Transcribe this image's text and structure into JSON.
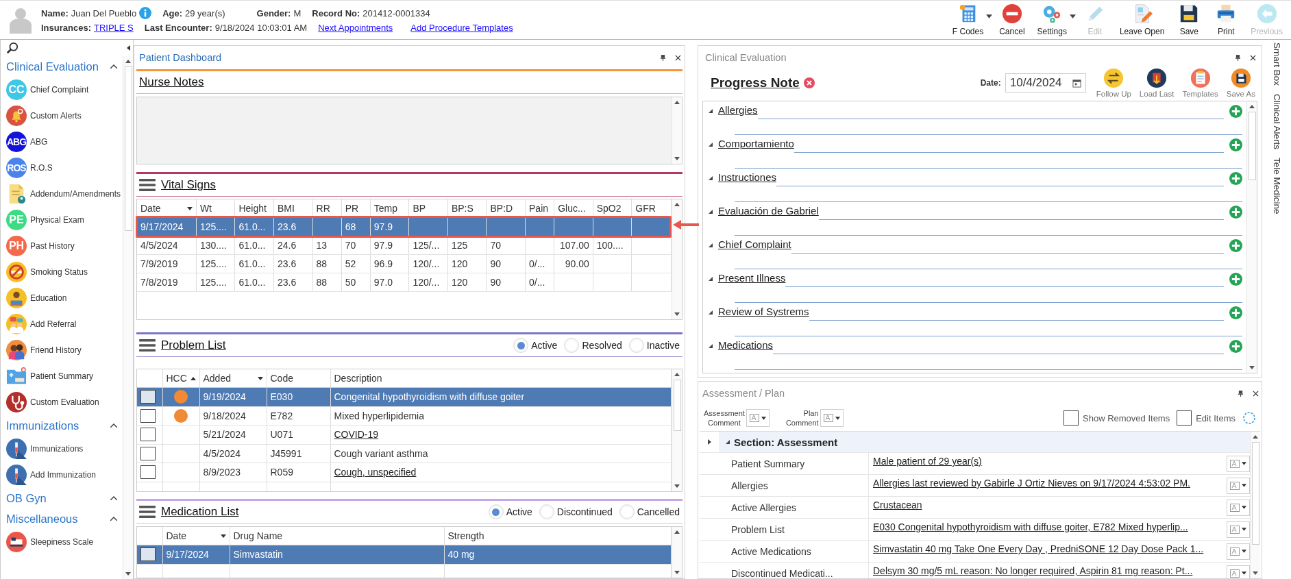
{
  "header": {
    "line1": [
      {
        "label": "Name:",
        "value": "Juan Del Pueblo",
        "info": true
      },
      {
        "label": "Age:",
        "value": "29 year(s)"
      },
      {
        "label": "Gender:",
        "value": "M"
      },
      {
        "label": "Record No:",
        "value": "201412-0001334"
      }
    ],
    "line2": [
      {
        "label": "Insurances:",
        "value": "TRIPLE S",
        "link": true
      },
      {
        "label": "Last Encounter:",
        "value": "9/18/2024 10:03:01 AM"
      }
    ],
    "links": [
      "Next Appointments",
      "Add Procedure Templates"
    ],
    "toolbar": [
      {
        "label": "F Codes",
        "menu": true,
        "disabled": false
      },
      {
        "label": "Cancel",
        "menu": false,
        "disabled": false
      },
      {
        "label": "Settings",
        "menu": true,
        "disabled": false
      },
      {
        "label": "Edit",
        "menu": false,
        "disabled": true
      },
      {
        "label": "Leave Open",
        "menu": false,
        "disabled": false
      },
      {
        "label": "Save",
        "menu": false,
        "disabled": false
      },
      {
        "label": "Print",
        "menu": false,
        "disabled": false
      },
      {
        "label": "Previous",
        "menu": false,
        "disabled": true
      }
    ]
  },
  "sidebar": {
    "groups": [
      {
        "title": "Clinical Evaluation",
        "expanded": true,
        "items": [
          {
            "label": "Chief Complaint",
            "badge": "CC",
            "color": "#3fc7e6"
          },
          {
            "label": "Custom Alerts"
          },
          {
            "label": "ABG",
            "badge": "ABG",
            "color": "#1212d8"
          },
          {
            "label": "R.O.S",
            "badge": "ROS",
            "color": "#4a83ea"
          },
          {
            "label": "Addendum/Amendments"
          },
          {
            "label": "Physical Exam",
            "badge": "PE",
            "color": "#3ddc84"
          },
          {
            "label": "Past History",
            "badge": "PH",
            "color": "#f4694b"
          },
          {
            "label": "Smoking Status"
          },
          {
            "label": "Education"
          },
          {
            "label": "Add Referral"
          },
          {
            "label": "Friend History"
          },
          {
            "label": "Patient Summary"
          },
          {
            "label": "Custom Evaluation"
          }
        ]
      },
      {
        "title": "Immunizations",
        "expanded": true,
        "items": [
          {
            "label": "Immunizations"
          },
          {
            "label": "Add Immunization"
          }
        ]
      },
      {
        "title": "OB Gyn",
        "expanded": true
      },
      {
        "title": "Miscellaneous",
        "expanded": true,
        "items": [
          {
            "label": "Sleepiness Scale"
          }
        ]
      }
    ]
  },
  "dashboard": {
    "title": "Patient Dashboard",
    "nurse_notes": {
      "title": "Nurse Notes"
    },
    "vital_signs": {
      "title": "Vital Signs",
      "columns": [
        {
          "label": "Date",
          "sort_ascending": false
        },
        {
          "label": "Wt"
        },
        {
          "label": "Height"
        },
        {
          "label": "BMI"
        },
        {
          "label": "RR"
        },
        {
          "label": "PR"
        },
        {
          "label": "Temp"
        },
        {
          "label": "BP"
        },
        {
          "label": "BP:S"
        },
        {
          "label": "BP:D"
        },
        {
          "label": "Pain"
        },
        {
          "label": "Gluc..."
        },
        {
          "label": "SpO2"
        },
        {
          "label": "GFR"
        }
      ],
      "rows": [
        {
          "selected": true,
          "highlighted": true,
          "cells": [
            "9/17/2024",
            "125....",
            "61.0...",
            "23.6",
            "",
            "68",
            "97.9",
            "",
            "",
            "",
            "",
            "",
            "",
            ""
          ]
        },
        {
          "selected": false,
          "highlighted": false,
          "cells": [
            "4/5/2024",
            "130....",
            "61.0...",
            "24.6",
            "13",
            "70",
            "97.9",
            "125/...",
            "125",
            "70",
            "",
            "107.00",
            "100....",
            ""
          ]
        },
        {
          "selected": false,
          "highlighted": false,
          "cells": [
            "7/9/2019",
            "125....",
            "61.0...",
            "23.6",
            "88",
            "52",
            "96.9",
            "120/...",
            "120",
            "90",
            "0/...",
            "90.00",
            "",
            ""
          ]
        },
        {
          "selected": false,
          "highlighted": false,
          "cells": [
            "7/8/2019",
            "125....",
            "61.0...",
            "23.6",
            "88",
            "50",
            "97.0",
            "120/...",
            "120",
            "90",
            "0/...",
            "",
            "",
            ""
          ]
        }
      ]
    },
    "problem_list": {
      "title": "Problem List",
      "filters": [
        {
          "label": "Active",
          "selected": true
        },
        {
          "label": "Resolved",
          "selected": false
        },
        {
          "label": "Inactive",
          "selected": false
        }
      ],
      "columns": [
        {
          "label": "HCC",
          "sort_ascending": true
        },
        {
          "label": "Added",
          "sort_ascending": false
        },
        {
          "label": "Code"
        },
        {
          "label": "Description"
        }
      ],
      "rows": [
        {
          "selected": true,
          "hcc": true,
          "added": "9/19/2024",
          "code": "E030",
          "description": "Congenital hypothyroidism with diffuse goiter",
          "link": false
        },
        {
          "selected": false,
          "hcc": true,
          "added": "9/18/2024",
          "code": "E782",
          "description": "Mixed hyperlipidemia",
          "link": false
        },
        {
          "selected": false,
          "hcc": false,
          "added": "5/21/2024",
          "code": "U071",
          "description": "COVID-19",
          "link": true
        },
        {
          "selected": false,
          "hcc": false,
          "added": "4/5/2024",
          "code": "J45991",
          "description": "Cough variant asthma",
          "link": false
        },
        {
          "selected": false,
          "hcc": false,
          "added": "8/9/2023",
          "code": "R059",
          "description": "Cough, unspecified",
          "link": true
        }
      ]
    },
    "medication_list": {
      "title": "Medication List",
      "filters": [
        {
          "label": "Active",
          "selected": true
        },
        {
          "label": "Discontinued",
          "selected": false
        },
        {
          "label": "Cancelled",
          "selected": false
        }
      ],
      "columns": [
        {
          "label": "Date",
          "sort_ascending": false
        },
        {
          "label": "Drug Name"
        },
        {
          "label": "Strength"
        }
      ],
      "rows": [
        {
          "selected": true,
          "date": "9/17/2024",
          "drug": "Simvastatin",
          "strength": "40 mg"
        }
      ]
    }
  },
  "clinical_evaluation": {
    "title": "Clinical Evaluation",
    "note_title": "Progress Note",
    "date_label": "Date:",
    "date": "10/4/2024",
    "actions": [
      "Follow Up",
      "Load Last",
      "Templates",
      "Save As"
    ],
    "sections": [
      {
        "title": "Allergies",
        "expanded": true
      },
      {
        "title": "Comportamiento",
        "expanded": true
      },
      {
        "title": "Instructiones",
        "expanded": true
      },
      {
        "title": "Evaluación de Gabriel",
        "expanded": true
      },
      {
        "title": "Chief Complaint",
        "expanded": true
      },
      {
        "title": "Present Illness",
        "expanded": true
      },
      {
        "title": "Review of Systrems",
        "expanded": true
      },
      {
        "title": "Medications",
        "expanded": true
      }
    ]
  },
  "assessment_plan": {
    "title": "Assessment / Plan",
    "pickers": [
      {
        "line1": "Assessment",
        "line2": "Comment"
      },
      {
        "line1": "Plan",
        "line2": "Comment"
      }
    ],
    "options": [
      {
        "label": "Show Removed Items",
        "checked": false
      },
      {
        "label": "Edit Items",
        "checked": false
      }
    ],
    "section": {
      "title": "Section: Assessment",
      "expanded": true
    },
    "rows": [
      {
        "label": "Patient Summary",
        "value": "Male patient of 29 year(s)"
      },
      {
        "label": "Allergies",
        "value": "Allergies last reviewed by Gabirle J Ortiz Nieves on 9/17/2024 4:53:02 PM."
      },
      {
        "label": "Active Allergies",
        "value": "Crustacean"
      },
      {
        "label": "Problem List",
        "value": "E030 Congenital hypothyroidism with diffuse goiter, E782 Mixed hyperlip..."
      },
      {
        "label": "Active Medications",
        "value": "Simvastatin 40 mg Take One Every Day , PredniSONE 12 Day Dose Pack 1..."
      },
      {
        "label": "Discontinued Medicati...",
        "value": "Delsym 30 mg/5 mL reason: No longer required, Aspirin 81 mg reason: Pt..."
      }
    ]
  },
  "side_tabs": [
    "Smart Box",
    "Clinical Alerts",
    "Tele Medicine"
  ]
}
